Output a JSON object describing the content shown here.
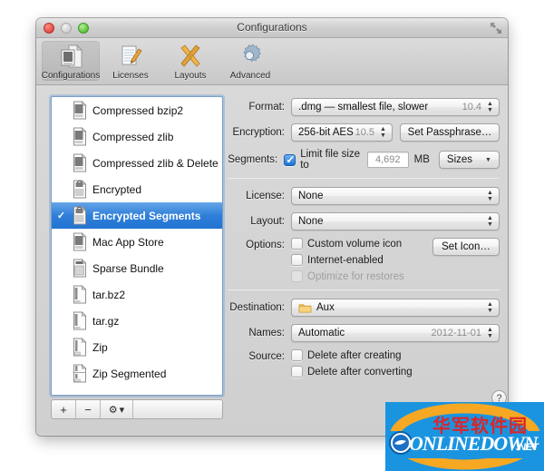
{
  "window": {
    "title": "Configurations",
    "traffic_lights": [
      "close",
      "minimize",
      "zoom"
    ],
    "fullscreen_icon": "fullscreen-arrows-icon"
  },
  "toolbar": {
    "items": [
      {
        "label": "Configurations",
        "icon": "document-config-icon",
        "selected": true
      },
      {
        "label": "Licenses",
        "icon": "document-pencil-icon",
        "selected": false
      },
      {
        "label": "Layouts",
        "icon": "crossed-tools-icon",
        "selected": false
      },
      {
        "label": "Advanced",
        "icon": "gear-icon",
        "selected": false
      }
    ]
  },
  "sidebar": {
    "items": [
      {
        "label": "Compressed bzip2",
        "icon": "document-icon",
        "selected": false
      },
      {
        "label": "Compressed zlib",
        "icon": "document-icon",
        "selected": false
      },
      {
        "label": "Compressed zlib & Delete",
        "icon": "document-icon",
        "selected": false
      },
      {
        "label": "Encrypted",
        "icon": "document-lock-icon",
        "selected": false
      },
      {
        "label": "Encrypted Segments",
        "icon": "document-lock-icon",
        "selected": true
      },
      {
        "label": "Mac App Store",
        "icon": "document-icon",
        "selected": false
      },
      {
        "label": "Sparse Bundle",
        "icon": "document-bundle-icon",
        "selected": false
      },
      {
        "label": "tar.bz2",
        "icon": "document-archive-icon",
        "selected": false
      },
      {
        "label": "tar.gz",
        "icon": "document-archive-icon",
        "selected": false
      },
      {
        "label": "Zip",
        "icon": "document-zip-icon",
        "selected": false
      },
      {
        "label": "Zip Segmented",
        "icon": "document-zip-segmented-icon",
        "selected": false
      }
    ],
    "checkmark": "✓",
    "toolbar": {
      "add_label": "+",
      "remove_label": "−",
      "gear_label": "⚙",
      "gear_arrow": "▾"
    }
  },
  "panel": {
    "format": {
      "label": "Format:",
      "value": ".dmg — smallest file, slower",
      "version": "10.4"
    },
    "encryption": {
      "label": "Encryption:",
      "value": "256-bit AES",
      "version": "10.5",
      "passphrase_button": "Set Passphrase…"
    },
    "segments": {
      "label": "Segments:",
      "checkbox_label": "Limit file size to",
      "checked": true,
      "size_value": "4,692",
      "unit": "MB",
      "sizes_menu": "Sizes"
    },
    "license": {
      "label": "License:",
      "value": "None"
    },
    "layout": {
      "label": "Layout:",
      "value": "None"
    },
    "options": {
      "label": "Options:",
      "set_icon_button": "Set Icon…",
      "checkboxes": [
        {
          "label": "Custom volume icon",
          "checked": false,
          "disabled": false
        },
        {
          "label": "Internet-enabled",
          "checked": false,
          "disabled": false
        },
        {
          "label": "Optimize for restores",
          "checked": false,
          "disabled": true
        }
      ]
    },
    "destination": {
      "label": "Destination:",
      "value": "Aux",
      "icon": "folder-icon"
    },
    "names": {
      "label": "Names:",
      "value": "Automatic",
      "date": "2012-11-01"
    },
    "source": {
      "label": "Source:",
      "checkboxes": [
        {
          "label": "Delete after creating",
          "checked": false
        },
        {
          "label": "Delete after converting",
          "checked": false
        }
      ]
    },
    "help_button": "?"
  },
  "watermark": {
    "chinese": "华军软件园",
    "english": "ONLINEDOWN",
    "tld": ".NET",
    "bg_color": "#1b94e0",
    "cn_color": "#d9262a"
  },
  "colors": {
    "selection_blue": "#2f7fd9",
    "checkbox_blue": "#1f72cf",
    "window_bg": "#d8d8d8"
  }
}
